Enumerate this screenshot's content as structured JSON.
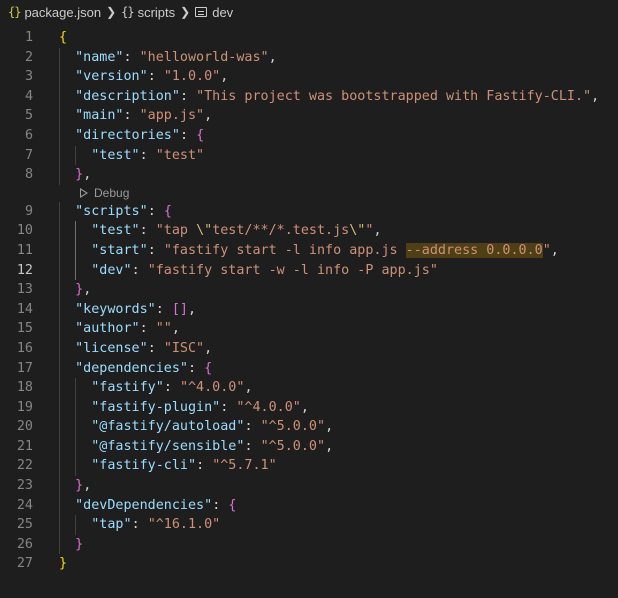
{
  "breadcrumb": {
    "file": "package.json",
    "section": "scripts",
    "item": "dev",
    "json_icon": "{}",
    "object_icon": "{}"
  },
  "codelens": {
    "label": "Debug"
  },
  "editor": {
    "current_line": 12,
    "line_numbers": [
      "1",
      "2",
      "3",
      "4",
      "5",
      "6",
      "7",
      "8",
      "9",
      "10",
      "11",
      "12",
      "13",
      "14",
      "15",
      "16",
      "17",
      "18",
      "19",
      "20",
      "21",
      "22",
      "23",
      "24",
      "25",
      "26",
      "27"
    ],
    "lines": [
      [
        {
          "t": "{",
          "c": "brace-y"
        }
      ],
      [
        {
          "t": "  "
        },
        {
          "t": "\"name\"",
          "c": "key"
        },
        {
          "t": ": "
        },
        {
          "t": "\"helloworld-was\"",
          "c": "str"
        },
        {
          "t": ","
        }
      ],
      [
        {
          "t": "  "
        },
        {
          "t": "\"version\"",
          "c": "key"
        },
        {
          "t": ": "
        },
        {
          "t": "\"1.0.0\"",
          "c": "str"
        },
        {
          "t": ","
        }
      ],
      [
        {
          "t": "  "
        },
        {
          "t": "\"description\"",
          "c": "key"
        },
        {
          "t": ": "
        },
        {
          "t": "\"This project was bootstrapped with Fastify-CLI.\"",
          "c": "str"
        },
        {
          "t": ","
        }
      ],
      [
        {
          "t": "  "
        },
        {
          "t": "\"main\"",
          "c": "key"
        },
        {
          "t": ": "
        },
        {
          "t": "\"app.js\"",
          "c": "str"
        },
        {
          "t": ","
        }
      ],
      [
        {
          "t": "  "
        },
        {
          "t": "\"directories\"",
          "c": "key"
        },
        {
          "t": ": "
        },
        {
          "t": "{",
          "c": "brace-p"
        }
      ],
      [
        {
          "t": "    "
        },
        {
          "t": "\"test\"",
          "c": "key"
        },
        {
          "t": ": "
        },
        {
          "t": "\"test\"",
          "c": "str"
        }
      ],
      [
        {
          "t": "  "
        },
        {
          "t": "}",
          "c": "brace-p"
        },
        {
          "t": ","
        }
      ],
      [
        {
          "t": "  "
        },
        {
          "t": "\"scripts\"",
          "c": "key"
        },
        {
          "t": ": "
        },
        {
          "t": "{",
          "c": "brace-p"
        }
      ],
      [
        {
          "t": "    "
        },
        {
          "t": "\"test\"",
          "c": "key"
        },
        {
          "t": ": "
        },
        {
          "t": "\"tap ",
          "c": "str"
        },
        {
          "t": "\\\"",
          "c": "esc"
        },
        {
          "t": "test/**/*.test.js",
          "c": "str"
        },
        {
          "t": "\\\"",
          "c": "esc"
        },
        {
          "t": "\"",
          "c": "str"
        },
        {
          "t": ","
        }
      ],
      [
        {
          "t": "    "
        },
        {
          "t": "\"start\"",
          "c": "key"
        },
        {
          "t": ": "
        },
        {
          "t": "\"fastify start -l info app.js ",
          "c": "str"
        },
        {
          "t": "--address 0.0.0.0",
          "c": "str hl"
        },
        {
          "t": "\"",
          "c": "str"
        },
        {
          "t": ","
        }
      ],
      [
        {
          "t": "    "
        },
        {
          "t": "\"dev\"",
          "c": "key"
        },
        {
          "t": ": "
        },
        {
          "t": "\"fastify start -w -l info -P app.js\"",
          "c": "str"
        }
      ],
      [
        {
          "t": "  "
        },
        {
          "t": "}",
          "c": "brace-p"
        },
        {
          "t": ","
        }
      ],
      [
        {
          "t": "  "
        },
        {
          "t": "\"keywords\"",
          "c": "key"
        },
        {
          "t": ": "
        },
        {
          "t": "[]",
          "c": "brace-p"
        },
        {
          "t": ","
        }
      ],
      [
        {
          "t": "  "
        },
        {
          "t": "\"author\"",
          "c": "key"
        },
        {
          "t": ": "
        },
        {
          "t": "\"\"",
          "c": "str"
        },
        {
          "t": ","
        }
      ],
      [
        {
          "t": "  "
        },
        {
          "t": "\"license\"",
          "c": "key"
        },
        {
          "t": ": "
        },
        {
          "t": "\"ISC\"",
          "c": "str"
        },
        {
          "t": ","
        }
      ],
      [
        {
          "t": "  "
        },
        {
          "t": "\"dependencies\"",
          "c": "key"
        },
        {
          "t": ": "
        },
        {
          "t": "{",
          "c": "brace-p"
        }
      ],
      [
        {
          "t": "    "
        },
        {
          "t": "\"fastify\"",
          "c": "key"
        },
        {
          "t": ": "
        },
        {
          "t": "\"^4.0.0\"",
          "c": "str"
        },
        {
          "t": ","
        }
      ],
      [
        {
          "t": "    "
        },
        {
          "t": "\"fastify-plugin\"",
          "c": "key"
        },
        {
          "t": ": "
        },
        {
          "t": "\"^4.0.0\"",
          "c": "str"
        },
        {
          "t": ","
        }
      ],
      [
        {
          "t": "    "
        },
        {
          "t": "\"@fastify/autoload\"",
          "c": "key"
        },
        {
          "t": ": "
        },
        {
          "t": "\"^5.0.0\"",
          "c": "str"
        },
        {
          "t": ","
        }
      ],
      [
        {
          "t": "    "
        },
        {
          "t": "\"@fastify/sensible\"",
          "c": "key"
        },
        {
          "t": ": "
        },
        {
          "t": "\"^5.0.0\"",
          "c": "str"
        },
        {
          "t": ","
        }
      ],
      [
        {
          "t": "    "
        },
        {
          "t": "\"fastify-cli\"",
          "c": "key"
        },
        {
          "t": ": "
        },
        {
          "t": "\"^5.7.1\"",
          "c": "str"
        }
      ],
      [
        {
          "t": "  "
        },
        {
          "t": "}",
          "c": "brace-p"
        },
        {
          "t": ","
        }
      ],
      [
        {
          "t": "  "
        },
        {
          "t": "\"devDependencies\"",
          "c": "key"
        },
        {
          "t": ": "
        },
        {
          "t": "{",
          "c": "brace-p"
        }
      ],
      [
        {
          "t": "    "
        },
        {
          "t": "\"tap\"",
          "c": "key"
        },
        {
          "t": ": "
        },
        {
          "t": "\"^16.1.0\"",
          "c": "str"
        }
      ],
      [
        {
          "t": "  "
        },
        {
          "t": "}",
          "c": "brace-p"
        }
      ],
      [
        {
          "t": "}",
          "c": "brace-y"
        }
      ]
    ]
  },
  "colors": {
    "background": "#1e1e1e",
    "key": "#9cdcfe",
    "string": "#ce9178",
    "escape": "#d7ba7d",
    "brace_level1": "#ffd700",
    "brace_level2": "#da70d6",
    "line_number": "#858585",
    "line_number_active": "#c6c6c6"
  }
}
